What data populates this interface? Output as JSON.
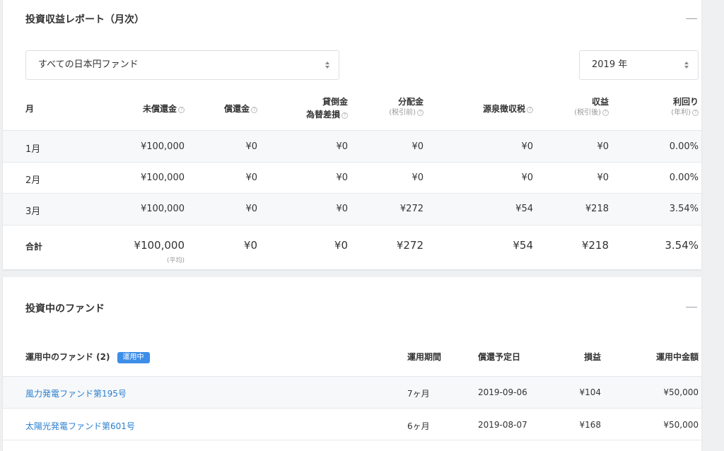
{
  "report": {
    "title": "投資収益レポート（月次）",
    "fund_select": {
      "value": "すべての日本円ファンド"
    },
    "year_select": {
      "value": "2019 年"
    },
    "columns": [
      {
        "label": "月",
        "sub": ""
      },
      {
        "label": "未償還金",
        "sub": ""
      },
      {
        "label": "償還金",
        "sub": ""
      },
      {
        "label": "貸倒金",
        "label2": "為替差損"
      },
      {
        "label": "分配金",
        "sub": "(税引前)"
      },
      {
        "label": "源泉徴収税",
        "sub": ""
      },
      {
        "label": "収益",
        "sub": "(税引後)"
      },
      {
        "label": "利回り",
        "sub": "(年利)"
      }
    ],
    "rows": [
      [
        "1月",
        "¥100,000",
        "¥0",
        "¥0",
        "¥0",
        "¥0",
        "¥0",
        "0.00%"
      ],
      [
        "2月",
        "¥100,000",
        "¥0",
        "¥0",
        "¥0",
        "¥0",
        "¥0",
        "0.00%"
      ],
      [
        "3月",
        "¥100,000",
        "¥0",
        "¥0",
        "¥272",
        "¥54",
        "¥218",
        "3.54%"
      ]
    ],
    "total": {
      "label": "合計",
      "values": [
        "¥100,000",
        "¥0",
        "¥0",
        "¥272",
        "¥54",
        "¥218",
        "3.54%"
      ],
      "avg_note": "(平均)"
    },
    "help_glyph": "?"
  },
  "funds": {
    "title": "投資中のファンド",
    "header": {
      "name": "運用中のファンド (2)",
      "badge": "運用中",
      "period": "運用期間",
      "redemption_date": "償還予定日",
      "profit": "損益",
      "amount": "運用中金額"
    },
    "rows": [
      {
        "name": "風力発電ファンド第195号",
        "period": "7ヶ月",
        "date": "2019-09-06",
        "profit": "¥104",
        "amount": "¥50,000"
      },
      {
        "name": "太陽光発電ファンド第601号",
        "period": "6ヶ月",
        "date": "2019-08-07",
        "profit": "¥168",
        "amount": "¥50,000"
      }
    ]
  },
  "colors": {
    "accent": "#3d8ee8",
    "link": "#2a7fcf",
    "row_alt": "#f7f8f9"
  }
}
